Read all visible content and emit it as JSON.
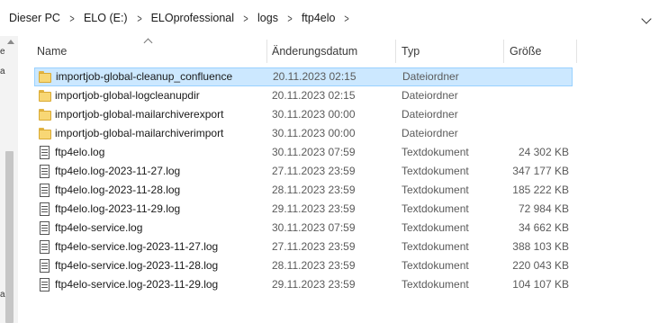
{
  "breadcrumb": [
    "Dieser PC",
    "ELO (E:)",
    "ELOprofessional",
    "logs",
    "ftp4elo"
  ],
  "breadcrumb_separator": ">",
  "nav_fragments": [
    "e",
    "a",
    "a"
  ],
  "columns": {
    "name": "Name",
    "date": "Änderungsdatum",
    "type": "Typ",
    "size": "Größe"
  },
  "files": [
    {
      "name": "importjob-global-cleanup_confluence",
      "date": "20.11.2023 02:15",
      "type": "Dateiordner",
      "size": "",
      "icon": "folder-icon",
      "selected": true
    },
    {
      "name": "importjob-global-logcleanupdir",
      "date": "20.11.2023 02:15",
      "type": "Dateiordner",
      "size": "",
      "icon": "folder-icon"
    },
    {
      "name": "importjob-global-mailarchiverexport",
      "date": "30.11.2023 00:00",
      "type": "Dateiordner",
      "size": "",
      "icon": "folder-icon"
    },
    {
      "name": "importjob-global-mailarchiverimport",
      "date": "30.11.2023 00:00",
      "type": "Dateiordner",
      "size": "",
      "icon": "folder-icon"
    },
    {
      "name": "ftp4elo.log",
      "date": "30.11.2023 07:59",
      "type": "Textdokument",
      "size": "24 302 KB",
      "icon": "text-document-icon"
    },
    {
      "name": "ftp4elo.log-2023-11-27.log",
      "date": "27.11.2023 23:59",
      "type": "Textdokument",
      "size": "347 177 KB",
      "icon": "text-document-icon"
    },
    {
      "name": "ftp4elo.log-2023-11-28.log",
      "date": "28.11.2023 23:59",
      "type": "Textdokument",
      "size": "185 222 KB",
      "icon": "text-document-icon"
    },
    {
      "name": "ftp4elo.log-2023-11-29.log",
      "date": "29.11.2023 23:59",
      "type": "Textdokument",
      "size": "72 984 KB",
      "icon": "text-document-icon"
    },
    {
      "name": "ftp4elo-service.log",
      "date": "30.11.2023 07:59",
      "type": "Textdokument",
      "size": "34 662 KB",
      "icon": "text-document-icon"
    },
    {
      "name": "ftp4elo-service.log-2023-11-27.log",
      "date": "27.11.2023 23:59",
      "type": "Textdokument",
      "size": "388 103 KB",
      "icon": "text-document-icon"
    },
    {
      "name": "ftp4elo-service.log-2023-11-28.log",
      "date": "28.11.2023 23:59",
      "type": "Textdokument",
      "size": "220 043 KB",
      "icon": "text-document-icon"
    },
    {
      "name": "ftp4elo-service.log-2023-11-29.log",
      "date": "29.11.2023 23:59",
      "type": "Textdokument",
      "size": "104 107 KB",
      "icon": "text-document-icon"
    }
  ],
  "colors": {
    "selection_fill": "#cce8ff",
    "selection_border": "#99d1ff",
    "folder_yellow": "#f8d775"
  }
}
